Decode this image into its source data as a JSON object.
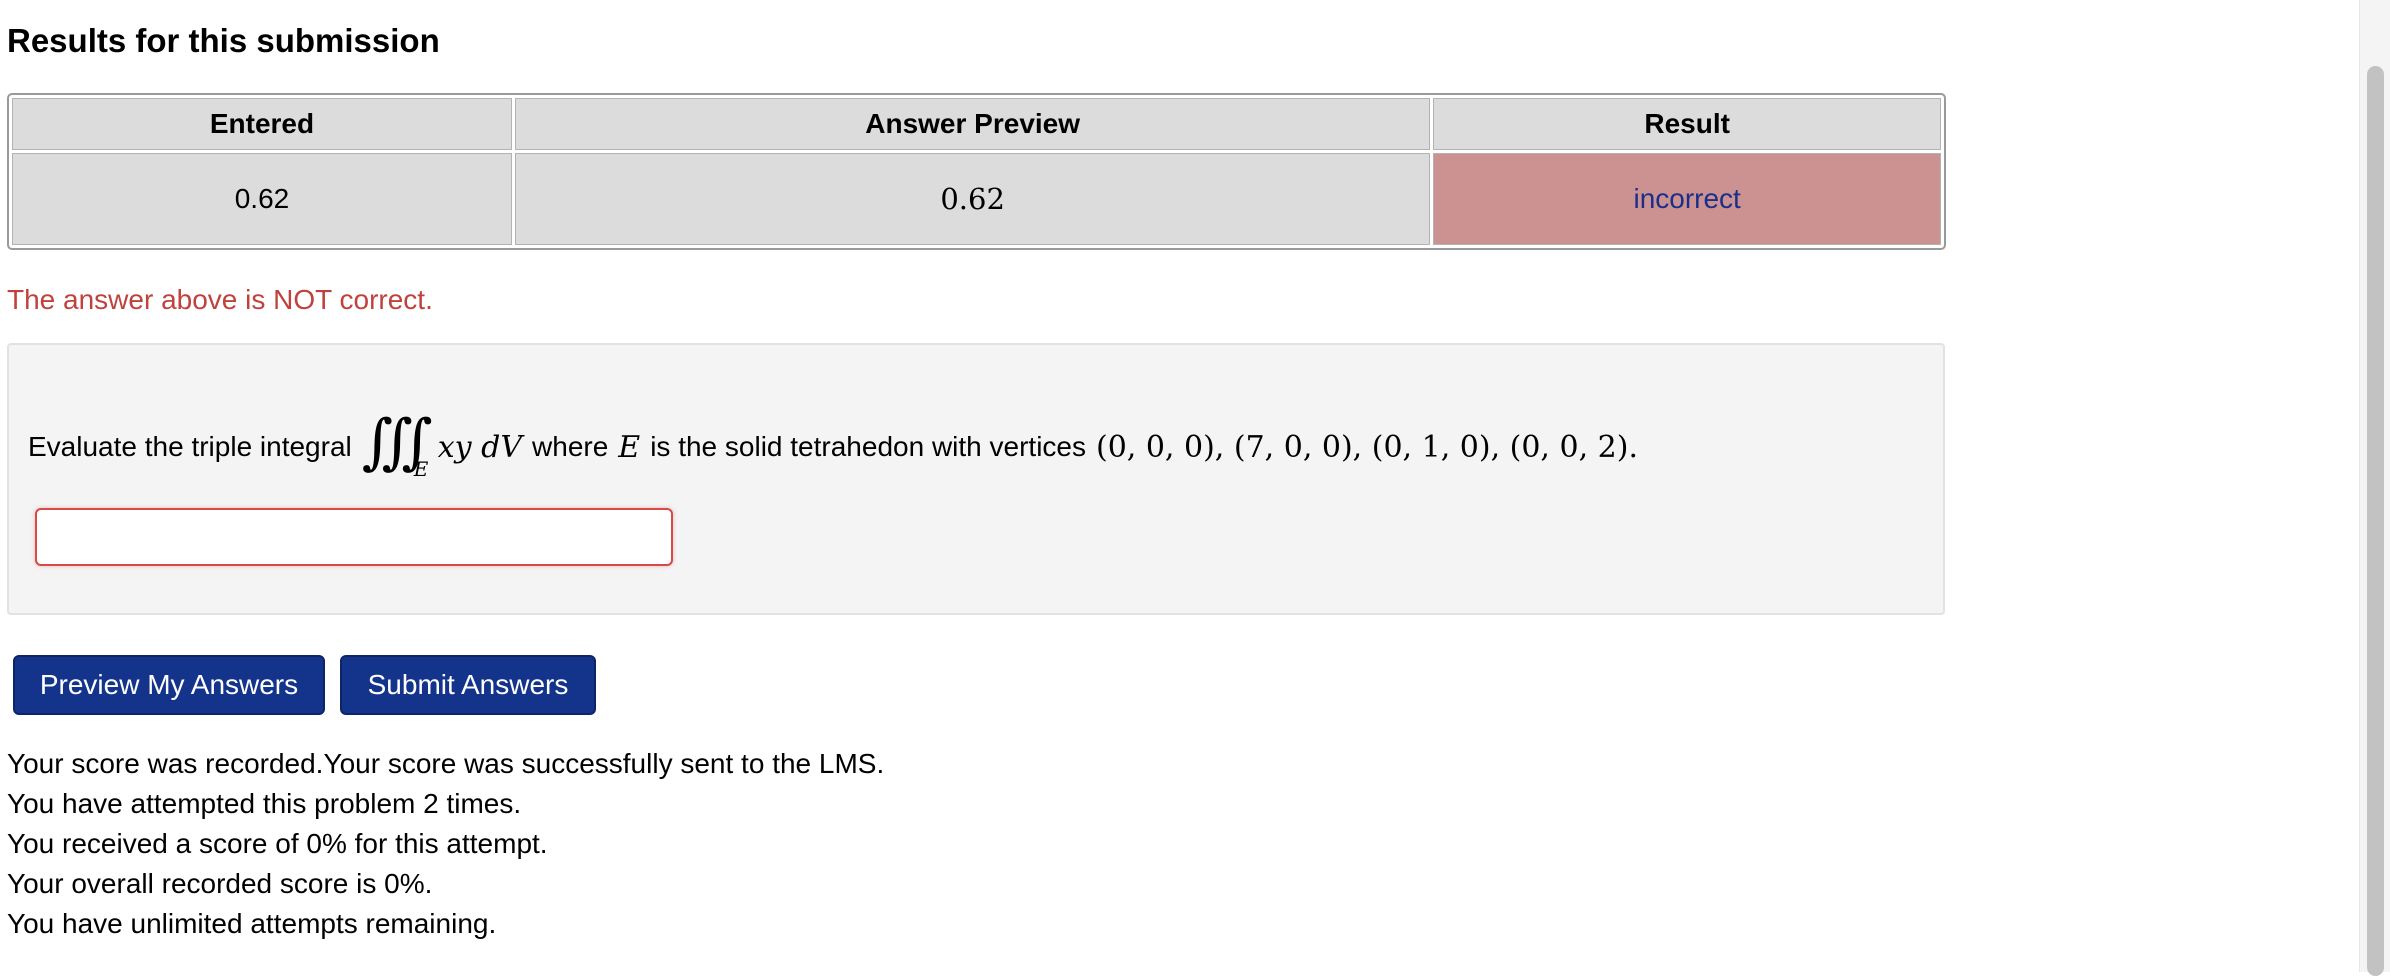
{
  "results": {
    "title": "Results for this submission",
    "headers": {
      "entered": "Entered",
      "preview": "Answer Preview",
      "result": "Result"
    },
    "row": {
      "entered": "0.62",
      "preview": "0.62",
      "result": "incorrect"
    }
  },
  "message": "The answer above is NOT correct.",
  "problem": {
    "prefix": "Evaluate the triple integral",
    "integral_sign": "∭",
    "integral_sub": "E",
    "integrand": "xy dV",
    "where_text": "where",
    "region_var": "E",
    "suffix": "is the solid tetrahedon with vertices",
    "vertices": "(0, 0, 0), (7, 0, 0), (0, 1, 0), (0, 0, 2).",
    "answer_value": ""
  },
  "buttons": {
    "preview": "Preview My Answers",
    "submit": "Submit Answers"
  },
  "score_lines": [
    "Your score was recorded.Your score was successfully sent to the LMS.",
    "You have attempted this problem 2 times.",
    "You received a score of 0% for this attempt.",
    "Your overall recorded score is 0%.",
    "You have unlimited attempts remaining."
  ],
  "colors": {
    "incorrect_bg": "#cc9292",
    "incorrect_text": "#1b2f8a",
    "message": "#c0423c",
    "button": "#14348c"
  }
}
